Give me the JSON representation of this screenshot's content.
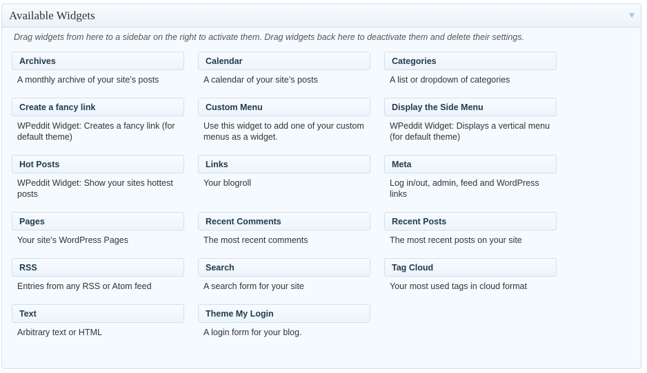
{
  "panel": {
    "title": "Available Widgets",
    "intro": "Drag widgets from here to a sidebar on the right to activate them. Drag widgets back here to deactivate them and delete their settings."
  },
  "widgets": [
    {
      "name": "Archives",
      "desc": "A monthly archive of your site’s posts"
    },
    {
      "name": "Calendar",
      "desc": "A calendar of your site’s posts"
    },
    {
      "name": "Categories",
      "desc": "A list or dropdown of categories"
    },
    {
      "name": "Create a fancy link",
      "desc": "WPeddit Widget: Creates a fancy link (for default theme)"
    },
    {
      "name": "Custom Menu",
      "desc": "Use this widget to add one of your custom menus as a widget."
    },
    {
      "name": "Display the Side Menu",
      "desc": "WPeddit Widget: Displays a vertical menu (for default theme)"
    },
    {
      "name": "Hot Posts",
      "desc": "WPeddit Widget: Show your sites hottest posts"
    },
    {
      "name": "Links",
      "desc": "Your blogroll"
    },
    {
      "name": "Meta",
      "desc": "Log in/out, admin, feed and WordPress links"
    },
    {
      "name": "Pages",
      "desc": "Your site’s WordPress Pages"
    },
    {
      "name": "Recent Comments",
      "desc": "The most recent comments"
    },
    {
      "name": "Recent Posts",
      "desc": "The most recent posts on your site"
    },
    {
      "name": "RSS",
      "desc": "Entries from any RSS or Atom feed"
    },
    {
      "name": "Search",
      "desc": "A search form for your site"
    },
    {
      "name": "Tag Cloud",
      "desc": "Your most used tags in cloud format"
    },
    {
      "name": "Text",
      "desc": "Arbitrary text or HTML"
    },
    {
      "name": "Theme My Login",
      "desc": "A login form for your blog."
    }
  ]
}
